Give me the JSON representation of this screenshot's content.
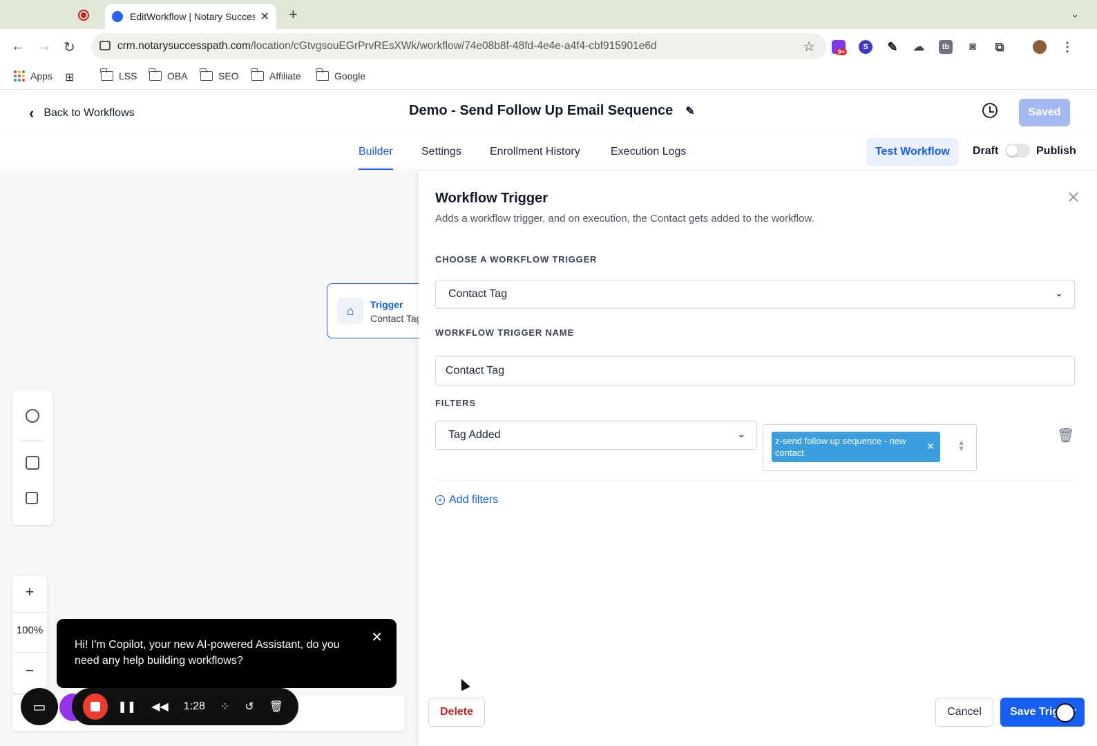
{
  "browser": {
    "tab_title": "EditWorkflow | Notary Success",
    "url_host": "crm.notarysuccesspath.com",
    "url_path": "/location/cGtvgsouEGrPrvREsXWk/workflow/74e08b8f-48fd-4e4e-a4f4-cbf915901e6d",
    "ext_badge": "9+",
    "ext_s": "S",
    "ext_tb": "tb",
    "bookmarks": [
      "Apps",
      "LSS",
      "OBA",
      "SEO",
      "Affiliate",
      "Google"
    ]
  },
  "header": {
    "back_label": "Back to Workflows",
    "title": "Demo - Send Follow Up Email Sequence",
    "saved_label": "Saved"
  },
  "tabs": {
    "items": [
      "Builder",
      "Settings",
      "Enrollment History",
      "Execution Logs"
    ],
    "active": "Builder",
    "test_label": "Test Workflow",
    "draft_label": "Draft",
    "publish_label": "Publish",
    "published": false
  },
  "canvas": {
    "node_title": "Trigger",
    "node_subtitle": "Contact Tag",
    "zoom_level": "100%",
    "zoom_in": "+",
    "zoom_out": "−"
  },
  "copilot": {
    "message": "Hi! I'm Copilot, your new AI-powered Assistant, do you need any help building workflows?"
  },
  "recorder": {
    "time": "1:28"
  },
  "panel": {
    "title": "Workflow Trigger",
    "description": "Adds a workflow trigger, and on execution, the Contact gets added to the workflow.",
    "choose_label": "CHOOSE A WORKFLOW TRIGGER",
    "trigger_value": "Contact Tag",
    "name_label": "WORKFLOW TRIGGER NAME",
    "name_value": "Contact Tag",
    "filters_label": "FILTERS",
    "filter_type": "Tag Added",
    "filter_tag": "z-send follow up sequence - new contact",
    "add_filters": "Add filters",
    "delete_label": "Delete",
    "cancel_label": "Cancel",
    "save_label": "Save Trigger"
  },
  "colors": {
    "primary": "#155eef",
    "saved_disabled": "#a4b8f2",
    "tag_chip": "#3b9ede",
    "delete_red": "#c81e1e"
  }
}
